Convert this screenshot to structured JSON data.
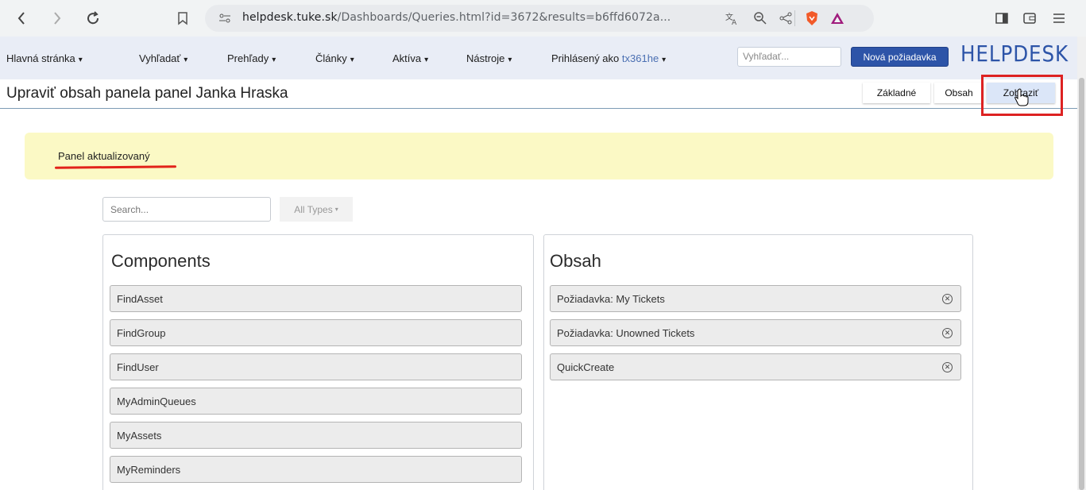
{
  "browser": {
    "url_host": "helpdesk.tuke.sk",
    "url_path": "/Dashboards/Queries.html?id=3672&results=b6ffd6072a..."
  },
  "nav": {
    "items": [
      "Hlavná stránka",
      "Vyhľadať",
      "Prehľady",
      "Články",
      "Aktíva",
      "Nástroje"
    ],
    "logged_in_label": "Prihlásený ako",
    "username": "tx361he",
    "search_placeholder": "Vyhľadať...",
    "new_ticket_label": "Nová požiadavka",
    "logo": "HELPDESK"
  },
  "page": {
    "title": "Upraviť obsah panela panel Janka Hraska",
    "tabs": [
      "Základné",
      "Obsah",
      "Zobraziť"
    ],
    "active_tab": "Zobraziť"
  },
  "notice": {
    "text": "Panel aktualizovaný"
  },
  "filters": {
    "search_placeholder": "Search...",
    "types_label": "All Types"
  },
  "components": {
    "title": "Components",
    "items": [
      "FindAsset",
      "FindGroup",
      "FindUser",
      "MyAdminQueues",
      "MyAssets",
      "MyReminders"
    ]
  },
  "content": {
    "title": "Obsah",
    "items": [
      "Požiadavka: My Tickets",
      "Požiadavka: Unowned Tickets",
      "QuickCreate"
    ]
  },
  "colors": {
    "brand_blue": "#2d54a8",
    "notice_bg": "#fbf9c5",
    "highlight_red": "#dd2222"
  }
}
